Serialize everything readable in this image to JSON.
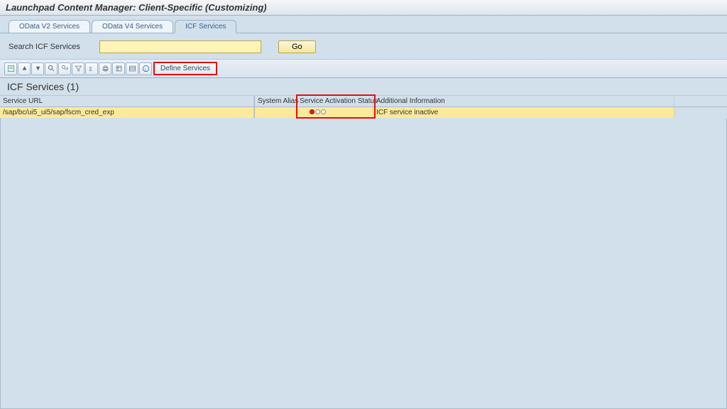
{
  "header": {
    "title": "Launchpad Content Manager: Client-Specific (Customizing)"
  },
  "tabs": {
    "items": [
      {
        "label": "OData V2 Services"
      },
      {
        "label": "OData V4 Services"
      },
      {
        "label": "ICF Services"
      }
    ]
  },
  "search": {
    "label": "Search ICF Services",
    "value": "",
    "go_label": "Go"
  },
  "toolbar": {
    "define_services_label": "Define Services"
  },
  "list": {
    "heading": "ICF Services (1)",
    "columns": {
      "service_url": "Service URL",
      "system_alias": "System Alias",
      "service_activation_status": "Service Activation Status",
      "additional_information": "Additional Information"
    },
    "rows": [
      {
        "service_url": "/sap/bc/ui5_ui5/sap/fscm_cred_exp",
        "system_alias": "",
        "status": "red",
        "additional_information": "ICF service inactive"
      }
    ]
  }
}
